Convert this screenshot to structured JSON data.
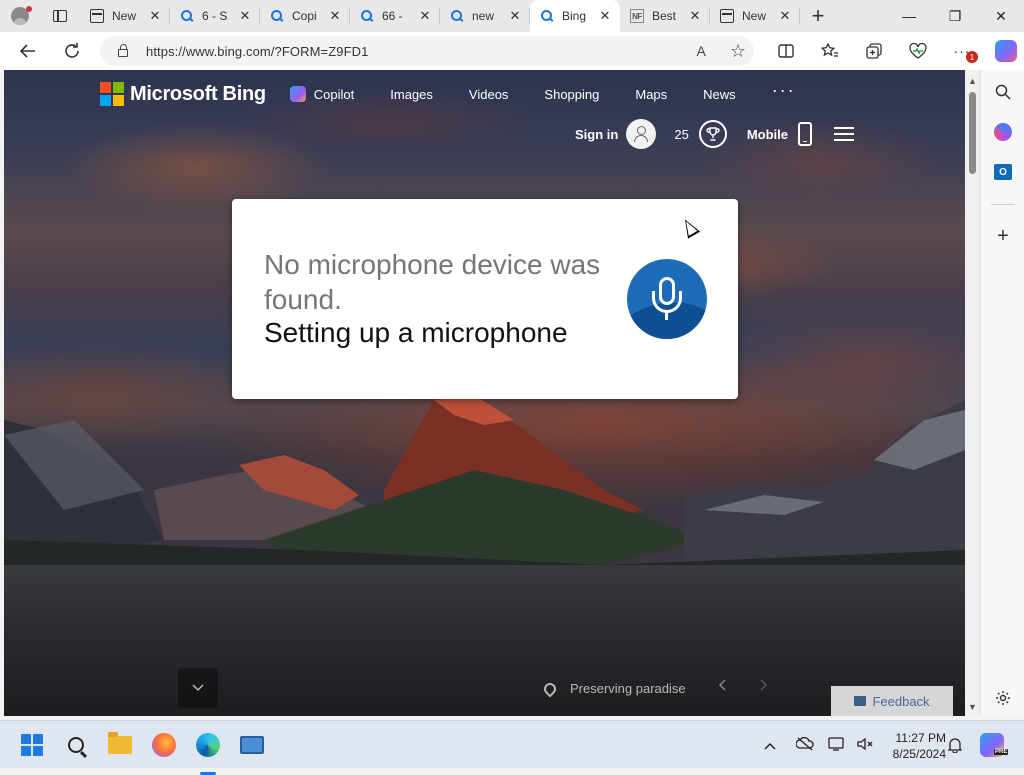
{
  "browser": {
    "tabs": [
      {
        "title": "New",
        "icon": "tab-page-icon",
        "active": false
      },
      {
        "title": "6 - S",
        "icon": "search-icon",
        "active": false
      },
      {
        "title": "Copi",
        "icon": "search-icon",
        "active": false
      },
      {
        "title": "66 -",
        "icon": "search-icon",
        "active": false
      },
      {
        "title": "new",
        "icon": "search-icon",
        "active": false
      },
      {
        "title": "Bing",
        "icon": "search-icon",
        "active": true
      },
      {
        "title": "Best",
        "icon": "nf-icon",
        "active": false
      },
      {
        "title": "New",
        "icon": "tab-page-icon",
        "active": false
      }
    ],
    "favicon_nf_text": "NF",
    "tab_close_glyph": "✕",
    "new_tab_glyph": "+",
    "window_controls": {
      "minimize": "—",
      "maximize": "❐",
      "close": "✕"
    },
    "url": "https://www.bing.com/?FORM=Z9FD1",
    "extension_badge": "1",
    "read_aloud_glyph": "A",
    "favorite_glyph": "☆"
  },
  "bing": {
    "brand": "Microsoft Bing",
    "nav": {
      "copilot": "Copilot",
      "images": "Images",
      "videos": "Videos",
      "shopping": "Shopping",
      "maps": "Maps",
      "news": "News",
      "more": "···"
    },
    "sign_in": "Sign in",
    "rewards_points": "25",
    "mobile": "Mobile",
    "location_caption": "Preserving paradise",
    "feedback": "Feedback"
  },
  "dialog": {
    "message": "No microphone device was found.",
    "link": "Setting up a microphone"
  },
  "taskbar": {
    "time": "11:27 PM",
    "date": "8/25/2024",
    "copilot_badge": "PRE"
  },
  "colors": {
    "accent": "#1e6bb8",
    "brand_red": "#f25022",
    "brand_green": "#7fba00",
    "brand_blue": "#00a4ef",
    "brand_yellow": "#ffb900"
  }
}
